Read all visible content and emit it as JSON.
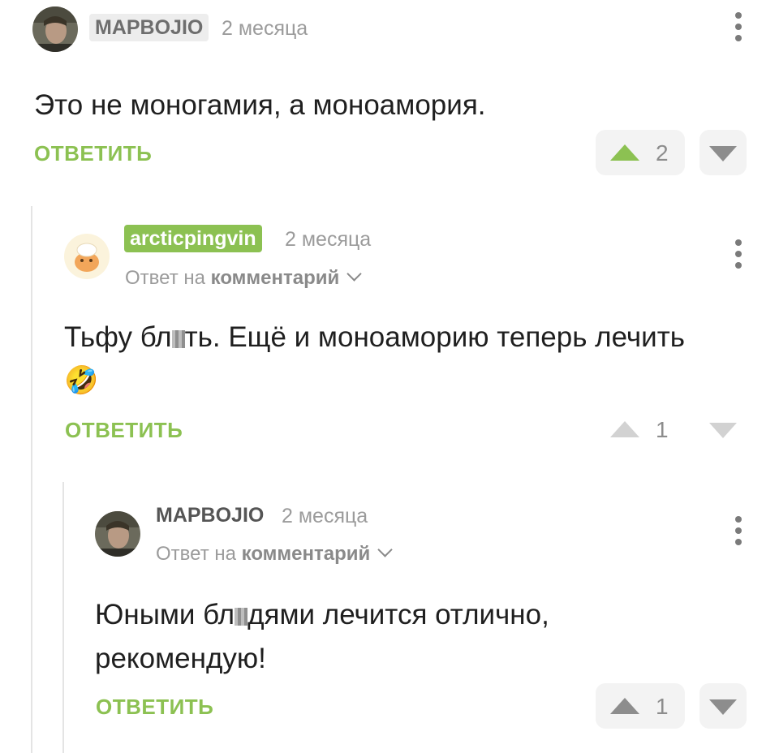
{
  "comments": [
    {
      "username": "MAPBOJIO",
      "time": "2 месяца",
      "text_parts": [
        "Это не моногамия, а моноамория."
      ],
      "reply_label": "ОТВЕТИТЬ",
      "votes": 2
    },
    {
      "username": "arcticpingvin",
      "time": "2 месяца",
      "reply_to_prefix": "Ответ на",
      "reply_to_link": "комментарий",
      "text_parts": [
        "Тьфу бл",
        "ть. Ещё и моноаморию теперь лечить"
      ],
      "emoji": "🤣",
      "reply_label": "ОТВЕТИТЬ",
      "votes": 1
    },
    {
      "username": "MAPBOJIO",
      "time": "2 месяца",
      "reply_to_prefix": "Ответ на",
      "reply_to_link": "комментарий",
      "text_parts": [
        "Юными бл",
        "дями лечится отлично,",
        "рекомендую!"
      ],
      "reply_label": "ОТВЕТИТЬ",
      "votes": 1
    }
  ],
  "colors": {
    "accent": "#8cc152",
    "muted": "#9b9b9b"
  },
  "icons": [
    "more-vertical-icon",
    "upvote-icon",
    "downvote-icon",
    "chevron-down-icon",
    "rofl-emoji-icon"
  ]
}
